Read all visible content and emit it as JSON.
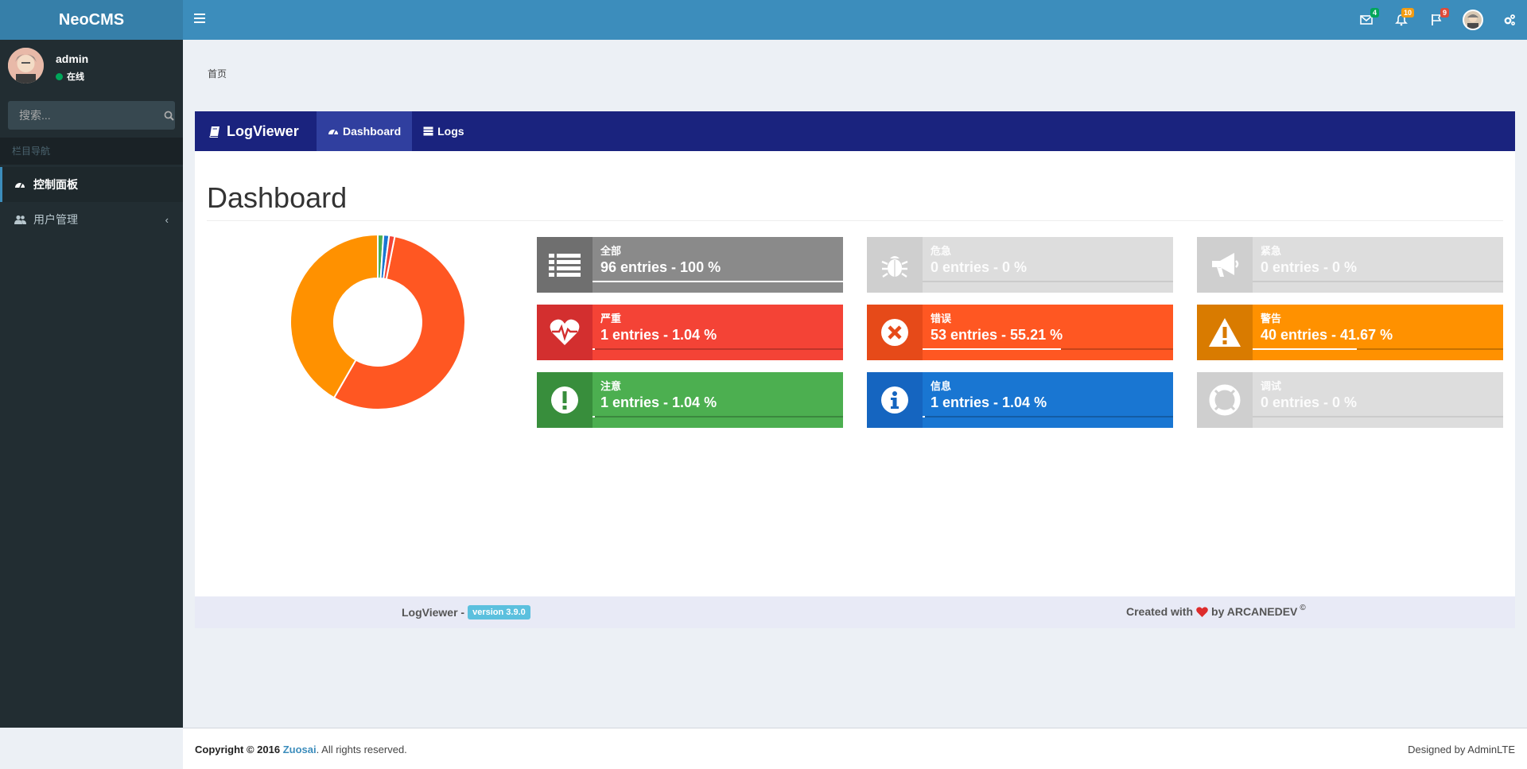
{
  "header": {
    "logo": "NeoCMS",
    "badges": {
      "messages": {
        "count": "4",
        "color": "#00a65a"
      },
      "notifications": {
        "count": "10",
        "color": "#f39c12"
      },
      "tasks": {
        "count": "9",
        "color": "#dd4b39"
      }
    }
  },
  "sidebar": {
    "user_name": "admin",
    "status": "在线",
    "search_placeholder": "搜索...",
    "menu_header": "栏目导航",
    "items": [
      {
        "label": "控制面板",
        "icon": "dashboard-icon",
        "active": true
      },
      {
        "label": "用户管理",
        "icon": "users-icon",
        "active": false
      }
    ]
  },
  "breadcrumb": "首页",
  "logviewer": {
    "brand": "LogViewer",
    "tabs": [
      {
        "label": "Dashboard",
        "icon": "dashboard-icon",
        "active": true
      },
      {
        "label": "Logs",
        "icon": "table-icon",
        "active": false
      }
    ],
    "title": "Dashboard",
    "cards": [
      {
        "key": "all",
        "label": "全部",
        "value": "96 entries - 100 %",
        "percent": 100,
        "icon": "list-icon",
        "bg": "#8a8a8a",
        "icon_bg": "#6f6f6f",
        "dim": false
      },
      {
        "key": "emergency",
        "label": "危急",
        "value": "0 entries - 0 %",
        "percent": 0,
        "icon": "bug-icon",
        "bg": "#dddddd",
        "icon_bg": "#cfcfcf",
        "dim": true
      },
      {
        "key": "alert",
        "label": "紧急",
        "value": "0 entries - 0 %",
        "percent": 0,
        "icon": "bullhorn-icon",
        "bg": "#dddddd",
        "icon_bg": "#cfcfcf",
        "dim": true
      },
      {
        "key": "critical",
        "label": "严重",
        "value": "1 entries - 1.04 %",
        "percent": 1.04,
        "icon": "heartbeat-icon",
        "bg": "#f44336",
        "icon_bg": "#d32f2f",
        "dim": false
      },
      {
        "key": "error",
        "label": "错误",
        "value": "53 entries - 55.21 %",
        "percent": 55.21,
        "icon": "times-circle-icon",
        "bg": "#ff5722",
        "icon_bg": "#e64a19",
        "dim": false
      },
      {
        "key": "warning",
        "label": "警告",
        "value": "40 entries - 41.67 %",
        "percent": 41.67,
        "icon": "warning-icon",
        "bg": "#ff9100",
        "icon_bg": "#d97b00",
        "dim": false
      },
      {
        "key": "notice",
        "label": "注意",
        "value": "1 entries - 1.04 %",
        "percent": 1.04,
        "icon": "exclamation-circle-icon",
        "bg": "#4caf50",
        "icon_bg": "#388e3c",
        "dim": false
      },
      {
        "key": "info",
        "label": "信息",
        "value": "1 entries - 1.04 %",
        "percent": 1.04,
        "icon": "info-circle-icon",
        "bg": "#1976d2",
        "icon_bg": "#1565c0",
        "dim": false
      },
      {
        "key": "debug",
        "label": "调试",
        "value": "0 entries - 0 %",
        "percent": 0,
        "icon": "life-ring-icon",
        "bg": "#dddddd",
        "icon_bg": "#cfcfcf",
        "dim": true
      }
    ],
    "footer_left": "LogViewer -",
    "version": "version 3.9.0",
    "footer_right_pre": "Created with",
    "footer_right_post": "by ARCANEDEV",
    "copyright_mark": "©"
  },
  "chart_data": {
    "type": "pie",
    "categories": [
      "错误",
      "警告",
      "注意",
      "信息",
      "严重"
    ],
    "values": [
      53,
      40,
      1,
      1,
      1
    ],
    "colors": [
      "#ff5722",
      "#ff9100",
      "#4caf50",
      "#1976d2",
      "#f44336"
    ],
    "legend": "none"
  },
  "footer": {
    "copyright_prefix": "Copyright © 2016",
    "company": "Zuosai",
    "rights": ". All rights reserved.",
    "designed": "Designed by AdminLTE"
  }
}
